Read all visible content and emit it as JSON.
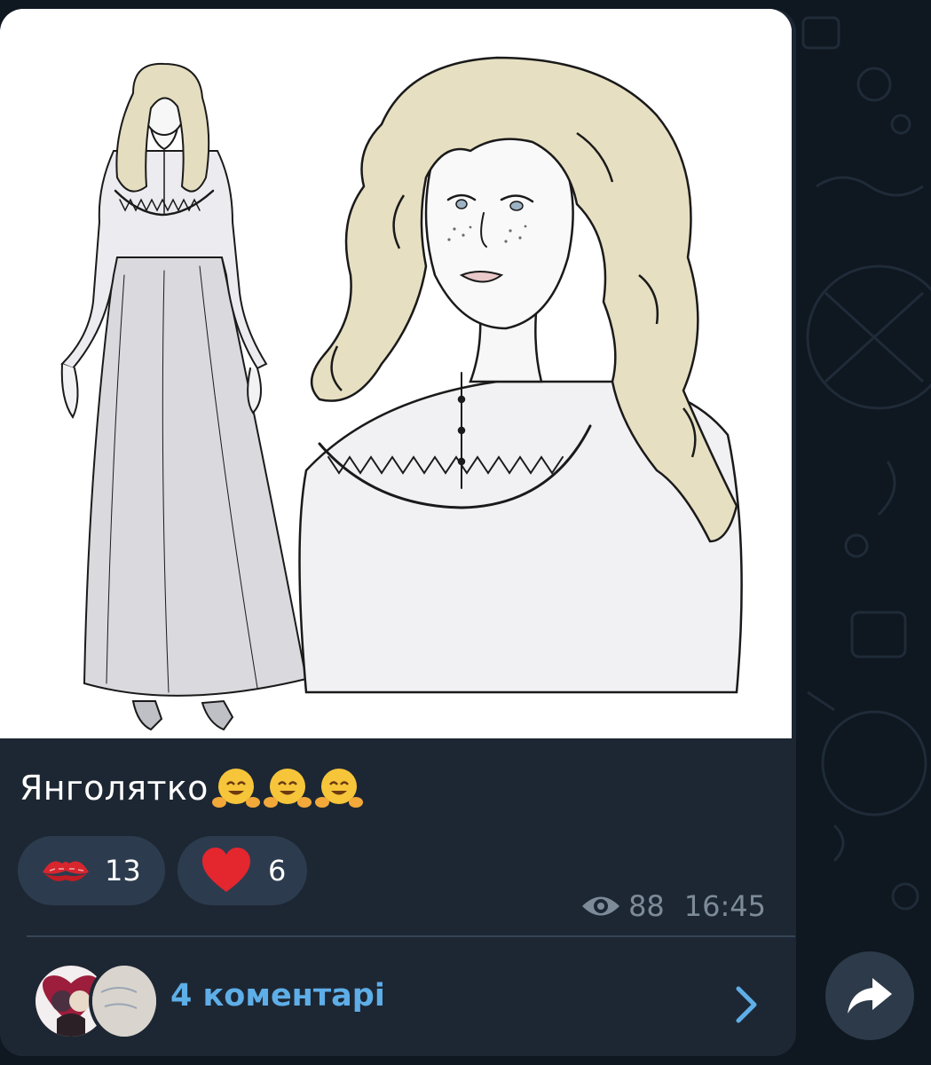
{
  "post": {
    "caption": "Янголятко",
    "caption_emoji": "hugging-face",
    "reactions": [
      {
        "icon": "kiss-mark-icon",
        "count": "13"
      },
      {
        "icon": "red-heart-icon",
        "count": "6"
      }
    ],
    "views": "88",
    "time": "16:45"
  },
  "comments": {
    "label": "4 коментарі"
  },
  "colors": {
    "bubble": "#1d2733",
    "background": "#0f1721",
    "accent": "#5eaee8",
    "reaction_pill": "#2c3c4e",
    "meta": "#7d8b99"
  }
}
